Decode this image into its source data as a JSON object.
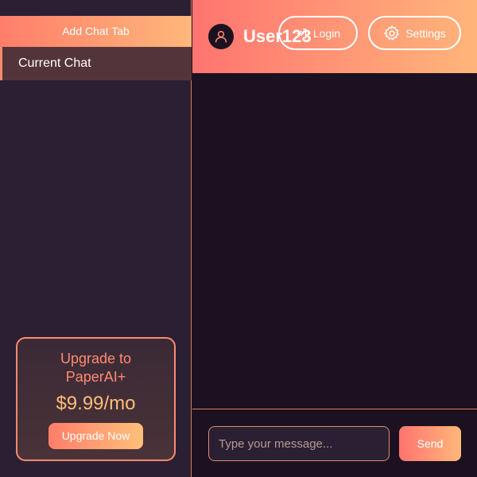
{
  "sidebar": {
    "add_tab_label": "Add Chat Tab",
    "tabs": [
      {
        "label": "Current Chat"
      }
    ],
    "upgrade": {
      "title": "Upgrade to PaperAI+",
      "price": "$9.99/mo",
      "button_label": "Upgrade Now"
    }
  },
  "header": {
    "avatar_icon": "user-icon",
    "username": "User123",
    "login_label": "Login",
    "login_icon": "login-icon",
    "settings_label": "Settings",
    "settings_icon": "gear-icon"
  },
  "composer": {
    "placeholder": "Type your message...",
    "value": "",
    "send_label": "Send"
  },
  "colors": {
    "accent_start": "#ff7470",
    "accent_end": "#ffb77a",
    "background": "#1c1120",
    "sidebar_bg": "#2a1f33"
  }
}
